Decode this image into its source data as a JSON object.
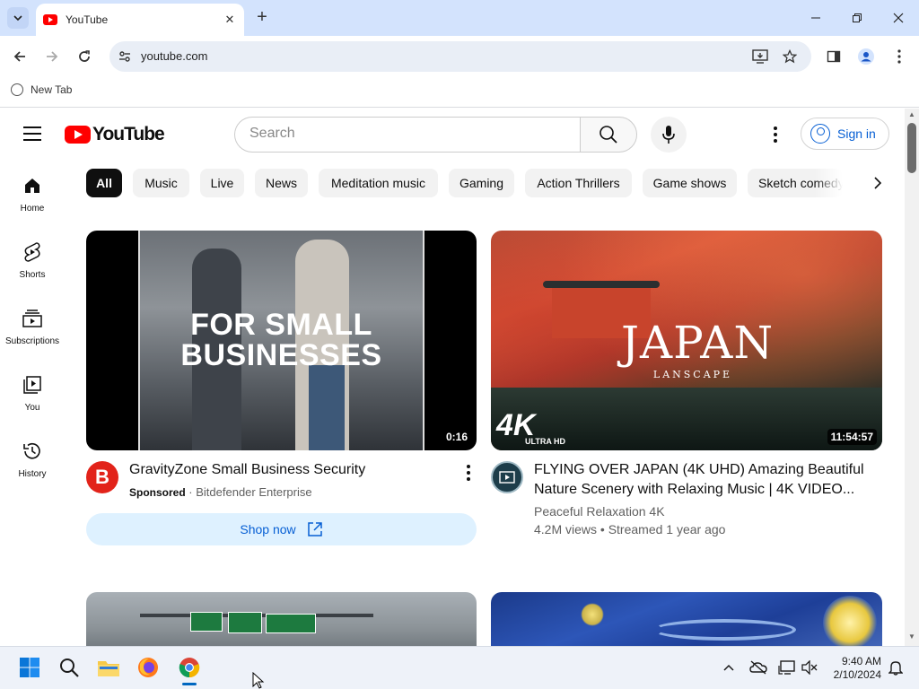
{
  "browser": {
    "tab_title": "YouTube",
    "url": "youtube.com",
    "bookmark": "New Tab"
  },
  "youtube": {
    "logo_text": "YouTube",
    "search_placeholder": "Search",
    "sign_in": "Sign in",
    "chips": [
      "All",
      "Music",
      "Live",
      "News",
      "Meditation music",
      "Gaming",
      "Action Thrillers",
      "Game shows",
      "Sketch comedy"
    ],
    "nav": [
      {
        "label": "Home",
        "icon": "home-icon"
      },
      {
        "label": "Shorts",
        "icon": "shorts-icon"
      },
      {
        "label": "Subscriptions",
        "icon": "subscriptions-icon"
      },
      {
        "label": "You",
        "icon": "you-icon"
      },
      {
        "label": "History",
        "icon": "history-icon"
      }
    ],
    "videos": [
      {
        "thumb_text": "FOR SMALL BUSINESSES",
        "duration": "0:16",
        "title": "GravityZone Small Business Security",
        "sponsored": "Sponsored",
        "channel": "Bitdefender Enterprise",
        "cta": "Shop now",
        "avatar_letter": "B"
      },
      {
        "thumb_text": "JAPAN",
        "thumb_subtext": "LANSCAPE",
        "thumb_badge": "4K",
        "thumb_badge_sub": "ULTRA HD",
        "duration": "11:54:57",
        "title_line1": "FLYING OVER JAPAN (4K UHD) Amazing Beautiful",
        "title_line2": "Nature Scenery with Relaxing Music | 4K VIDEO...",
        "channel": "Peaceful Relaxation 4K",
        "stats": "4.2M views • Streamed 1 year ago"
      }
    ]
  },
  "taskbar": {
    "time": "9:40 AM",
    "date": "2/10/2024"
  }
}
